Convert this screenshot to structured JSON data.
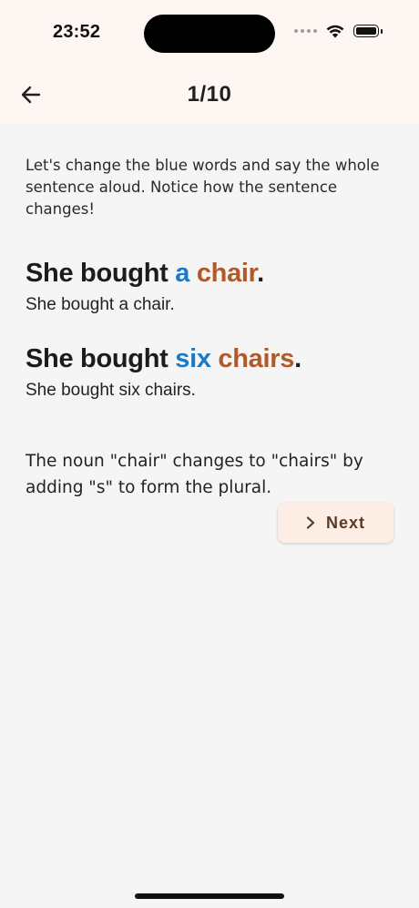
{
  "status_bar": {
    "time": "23:52",
    "icons": [
      "cellular-icon",
      "wifi-icon",
      "battery-icon"
    ]
  },
  "header": {
    "title": "1/10",
    "back_icon": "arrow-left-icon"
  },
  "lesson": {
    "instruction": "Let's change the blue words and say the whole sentence aloud. Notice how the sentence changes!",
    "examples": [
      {
        "base": "She bought ",
        "blue": "a",
        "space": " ",
        "orange": "chair",
        "end": ".",
        "plain": "She bought a chair."
      },
      {
        "base": "She bought ",
        "blue": "six",
        "space": " ",
        "orange": "chairs",
        "end": ".",
        "plain": "She bought six chairs."
      }
    ],
    "explanation": "The noun \"chair\" changes to \"chairs\" by adding \"s\" to form the plural."
  },
  "next_button": {
    "label": "Next",
    "icon": "chevron-right-icon"
  },
  "colors": {
    "blue_word": "#1a7ac7",
    "orange_word": "#b0592a",
    "header_bg": "#fdf6f2",
    "page_bg": "#f5f5f5",
    "next_bg": "#fdeee5"
  }
}
